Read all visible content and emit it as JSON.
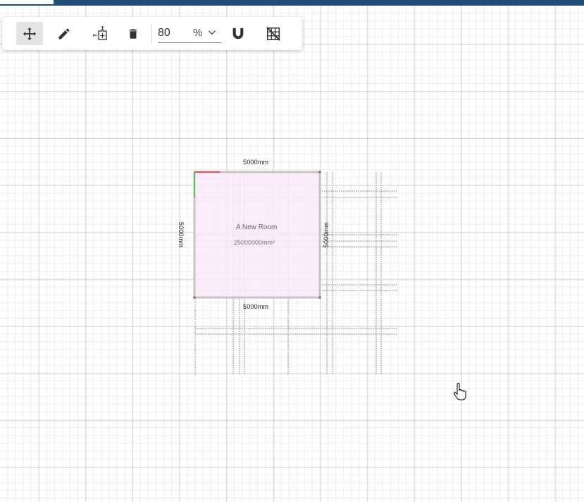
{
  "toolbar": {
    "tools": [
      {
        "name": "move",
        "icon": "move-arrows-icon",
        "active": true
      },
      {
        "name": "draw",
        "icon": "pencil-icon",
        "active": false
      },
      {
        "name": "measure",
        "icon": "dimension-measure-icon",
        "active": false
      },
      {
        "name": "delete",
        "icon": "trash-icon",
        "active": false
      },
      {
        "name": "snap",
        "icon": "magnet-icon",
        "active": false
      },
      {
        "name": "grid",
        "icon": "grid-off-icon",
        "active": false
      }
    ],
    "zoom": {
      "value": "80",
      "unit": "%"
    }
  },
  "room": {
    "name": "A New Room",
    "area": "25000000mm²",
    "fill_color": "#fbe9fb",
    "wall_color": "#c4c4c4",
    "dimensions": {
      "top": "5000mm",
      "bottom": "5000mm",
      "left": "5000mm",
      "right": "5000mm"
    }
  },
  "colors": {
    "header": "#1f4e79",
    "axis_x": "#e05555",
    "axis_y": "#55c455"
  }
}
